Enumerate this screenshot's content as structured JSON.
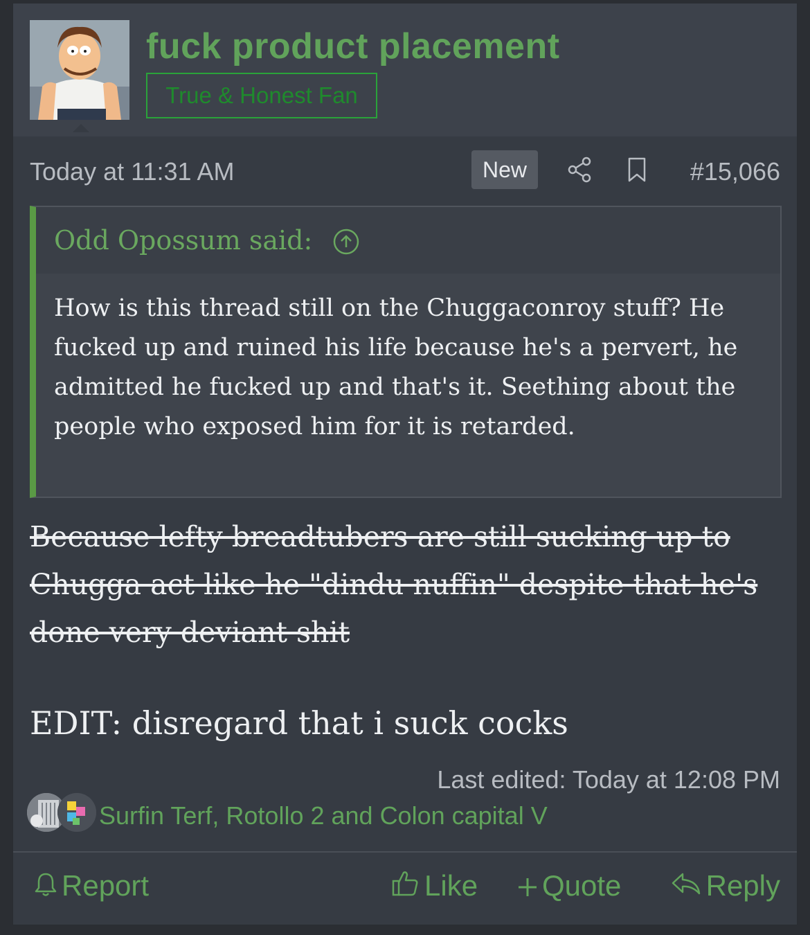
{
  "post": {
    "username": "fuck product placement",
    "user_title": "True & Honest Fan",
    "timestamp": "Today at 11:31 AM",
    "new_badge": "New",
    "post_number": "#15,066",
    "quote": {
      "author_line": "Odd Opossum said:",
      "text": "How is this thread still on the Chuggaconroy stuff? He fucked up and ruined his life because he's a pervert, he admitted he fucked up and that's it. Seething about the people who exposed him for it is retarded."
    },
    "struck_text": "Because lefty breadtubers are still sucking up to Chugga act like he \"dindu nuffin\" despite that he's done very deviant shit",
    "edit_text": "EDIT: disregard that i suck cocks",
    "last_edited": "Last edited: Today at 12:08 PM",
    "reactions": {
      "users": "Surfin Terf, Rotollo 2 and Colon capital V"
    },
    "actions": {
      "report": "Report",
      "like": "Like",
      "quote": "Quote",
      "reply": "Reply"
    }
  },
  "colors": {
    "accent_green": "#61a35b",
    "post_bg": "#363b43",
    "header_bg": "#3d424b",
    "quote_border": "#5a9a45"
  }
}
